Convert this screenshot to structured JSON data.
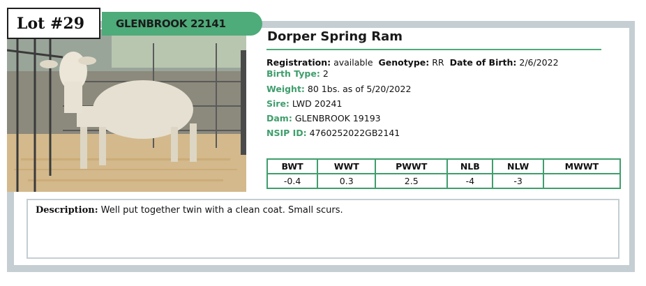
{
  "lot": {
    "label": "Lot #29"
  },
  "farm": {
    "tag": "GLENBROOK 22141"
  },
  "animal": {
    "title": "Dorper Spring Ram",
    "registration_label": "Registration:",
    "registration_value": "available",
    "genotype_label": "Genotype:",
    "genotype_value": "RR",
    "dob_label": "Date of Birth:",
    "dob_value": "2/6/2022",
    "birth_type_label": "Birth Type:",
    "birth_type_value": "2",
    "weight_label": "Weight:",
    "weight_value": "80 1bs. as of 5/20/2022",
    "sire_label": "Sire:",
    "sire_value": "LWD 20241",
    "dam_label": "Dam:",
    "dam_value": "GLENBROOK 19193",
    "nsip_label": "NSIP ID:",
    "nsip_value": "4760252022GB2141"
  },
  "epd": {
    "headers": [
      "BWT",
      "WWT",
      "PWWT",
      "NLB",
      "NLW",
      "MWWT"
    ],
    "values": [
      "-0.4",
      "0.3",
      "2.5",
      "-4",
      "-3",
      ""
    ]
  },
  "description": {
    "label": "Description:",
    "text": "Well put together twin with a clean coat. Small scurs."
  },
  "colors": {
    "accent_green": "#4eab7a",
    "label_green": "#3f9e6c",
    "frame_gray": "#c4ced3"
  }
}
